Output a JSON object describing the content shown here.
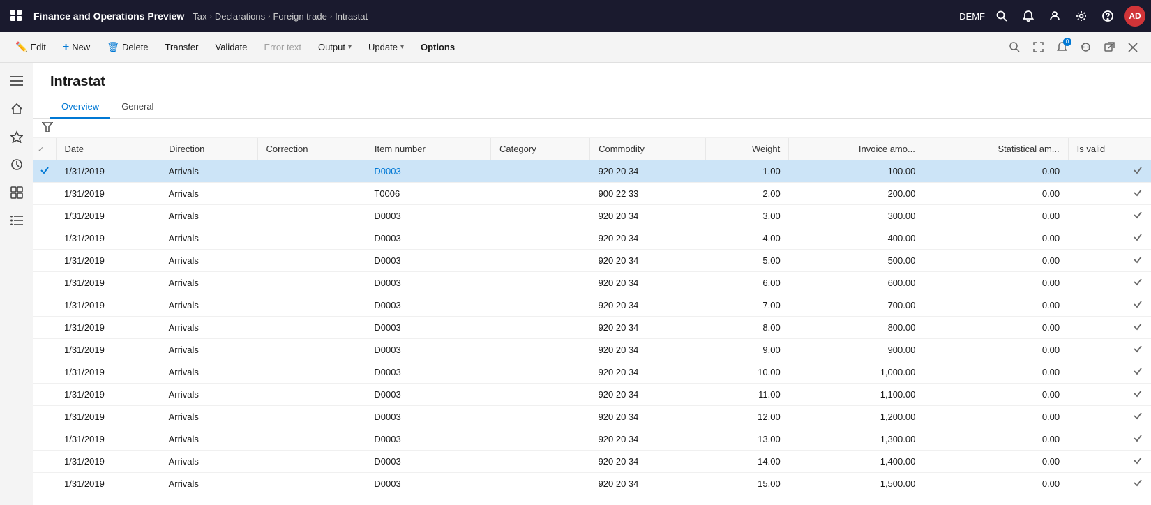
{
  "topnav": {
    "app_title": "Finance and Operations Preview",
    "breadcrumb": [
      "Tax",
      "Declarations",
      "Foreign trade",
      "Intrastat"
    ],
    "company": "DEMF",
    "avatar_initials": "AD"
  },
  "actionbar": {
    "edit_label": "Edit",
    "new_label": "New",
    "delete_label": "Delete",
    "transfer_label": "Transfer",
    "validate_label": "Validate",
    "errortext_label": "Error text",
    "output_label": "Output",
    "update_label": "Update",
    "options_label": "Options"
  },
  "page": {
    "title": "Intrastat",
    "tabs": [
      "Overview",
      "General"
    ]
  },
  "table": {
    "columns": [
      "",
      "Date",
      "Direction",
      "Correction",
      "Item number",
      "Category",
      "Commodity",
      "Weight",
      "Invoice amo...",
      "Statistical am...",
      "Is valid"
    ],
    "rows": [
      {
        "date": "1/31/2019",
        "direction": "Arrivals",
        "correction": "",
        "item_number": "D0003",
        "category": "",
        "commodity": "920 20 34",
        "weight": "1.00",
        "invoice": "100.00",
        "statistical": "0.00",
        "valid": true,
        "selected": true
      },
      {
        "date": "1/31/2019",
        "direction": "Arrivals",
        "correction": "",
        "item_number": "T0006",
        "category": "",
        "commodity": "900 22 33",
        "weight": "2.00",
        "invoice": "200.00",
        "statistical": "0.00",
        "valid": true,
        "selected": false
      },
      {
        "date": "1/31/2019",
        "direction": "Arrivals",
        "correction": "",
        "item_number": "D0003",
        "category": "",
        "commodity": "920 20 34",
        "weight": "3.00",
        "invoice": "300.00",
        "statistical": "0.00",
        "valid": true,
        "selected": false
      },
      {
        "date": "1/31/2019",
        "direction": "Arrivals",
        "correction": "",
        "item_number": "D0003",
        "category": "",
        "commodity": "920 20 34",
        "weight": "4.00",
        "invoice": "400.00",
        "statistical": "0.00",
        "valid": true,
        "selected": false
      },
      {
        "date": "1/31/2019",
        "direction": "Arrivals",
        "correction": "",
        "item_number": "D0003",
        "category": "",
        "commodity": "920 20 34",
        "weight": "5.00",
        "invoice": "500.00",
        "statistical": "0.00",
        "valid": true,
        "selected": false
      },
      {
        "date": "1/31/2019",
        "direction": "Arrivals",
        "correction": "",
        "item_number": "D0003",
        "category": "",
        "commodity": "920 20 34",
        "weight": "6.00",
        "invoice": "600.00",
        "statistical": "0.00",
        "valid": true,
        "selected": false
      },
      {
        "date": "1/31/2019",
        "direction": "Arrivals",
        "correction": "",
        "item_number": "D0003",
        "category": "",
        "commodity": "920 20 34",
        "weight": "7.00",
        "invoice": "700.00",
        "statistical": "0.00",
        "valid": true,
        "selected": false
      },
      {
        "date": "1/31/2019",
        "direction": "Arrivals",
        "correction": "",
        "item_number": "D0003",
        "category": "",
        "commodity": "920 20 34",
        "weight": "8.00",
        "invoice": "800.00",
        "statistical": "0.00",
        "valid": true,
        "selected": false
      },
      {
        "date": "1/31/2019",
        "direction": "Arrivals",
        "correction": "",
        "item_number": "D0003",
        "category": "",
        "commodity": "920 20 34",
        "weight": "9.00",
        "invoice": "900.00",
        "statistical": "0.00",
        "valid": true,
        "selected": false
      },
      {
        "date": "1/31/2019",
        "direction": "Arrivals",
        "correction": "",
        "item_number": "D0003",
        "category": "",
        "commodity": "920 20 34",
        "weight": "10.00",
        "invoice": "1,000.00",
        "statistical": "0.00",
        "valid": true,
        "selected": false
      },
      {
        "date": "1/31/2019",
        "direction": "Arrivals",
        "correction": "",
        "item_number": "D0003",
        "category": "",
        "commodity": "920 20 34",
        "weight": "11.00",
        "invoice": "1,100.00",
        "statistical": "0.00",
        "valid": true,
        "selected": false
      },
      {
        "date": "1/31/2019",
        "direction": "Arrivals",
        "correction": "",
        "item_number": "D0003",
        "category": "",
        "commodity": "920 20 34",
        "weight": "12.00",
        "invoice": "1,200.00",
        "statistical": "0.00",
        "valid": true,
        "selected": false
      },
      {
        "date": "1/31/2019",
        "direction": "Arrivals",
        "correction": "",
        "item_number": "D0003",
        "category": "",
        "commodity": "920 20 34",
        "weight": "13.00",
        "invoice": "1,300.00",
        "statistical": "0.00",
        "valid": true,
        "selected": false
      },
      {
        "date": "1/31/2019",
        "direction": "Arrivals",
        "correction": "",
        "item_number": "D0003",
        "category": "",
        "commodity": "920 20 34",
        "weight": "14.00",
        "invoice": "1,400.00",
        "statistical": "0.00",
        "valid": true,
        "selected": false
      },
      {
        "date": "1/31/2019",
        "direction": "Arrivals",
        "correction": "",
        "item_number": "D0003",
        "category": "",
        "commodity": "920 20 34",
        "weight": "15.00",
        "invoice": "1,500.00",
        "statistical": "0.00",
        "valid": true,
        "selected": false
      }
    ]
  }
}
